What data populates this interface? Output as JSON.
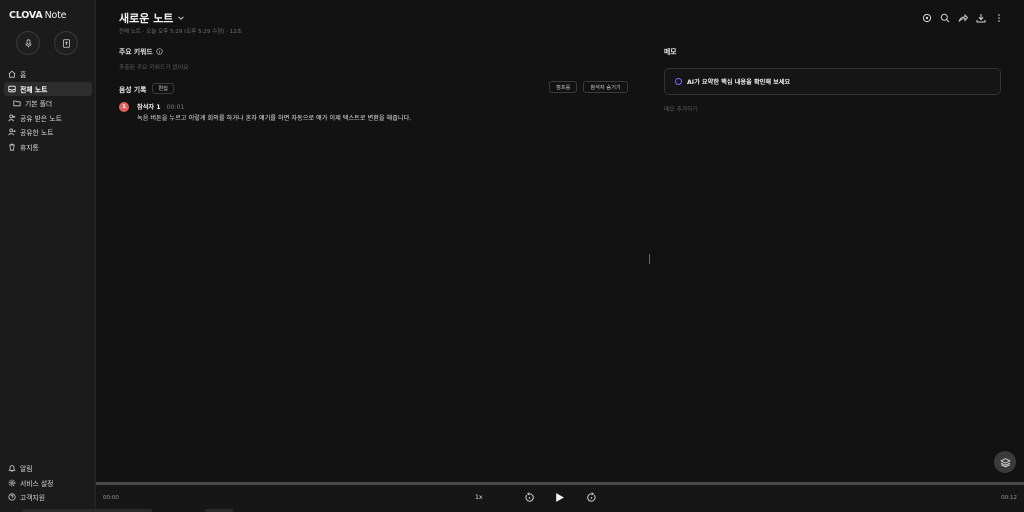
{
  "app": {
    "logo_bold": "CLOVA",
    "logo_light": "Note"
  },
  "sidebar": {
    "items": [
      {
        "label": "홈",
        "icon": "home-icon",
        "active": false
      },
      {
        "label": "전체 노트",
        "icon": "inbox-icon",
        "active": true
      },
      {
        "label": "기본 폴더",
        "icon": "folder-icon",
        "active": false
      },
      {
        "label": "공유 받은 노트",
        "icon": "user-received-icon",
        "active": false
      },
      {
        "label": "공유한 노트",
        "icon": "user-shared-icon",
        "active": false
      },
      {
        "label": "휴지통",
        "icon": "trash-icon",
        "active": false
      }
    ],
    "bottom": [
      {
        "label": "알림",
        "icon": "bell-icon"
      },
      {
        "label": "서비스 설정",
        "icon": "gear-icon"
      },
      {
        "label": "고객지원",
        "icon": "help-icon"
      }
    ]
  },
  "note": {
    "title": "새로운 노트",
    "meta": "전체 노트 · 오늘 오후 5:29 (오후 5:29 수정) · 12초"
  },
  "keywords": {
    "title": "주요 키워드",
    "empty": "추출된 주요 키워드가 없어요"
  },
  "recording": {
    "title": "음성 기록",
    "edit_label": "편집",
    "btn_jump": "점프를",
    "btn_hide_speaker": "참석자 숨기기"
  },
  "utterances": [
    {
      "speaker_index": "1",
      "speaker": "참석자 1",
      "time": "00:01",
      "text": "녹음 버튼을 누르고 이렇게 회의를 하거나 혼자 얘기를 하면 자동으로 얘가 이제 텍스트로 변환을 해줍니다."
    }
  ],
  "memo": {
    "title": "메모",
    "ai_prompt": "AI가 요약한 핵심 내용을 확인해 보세요",
    "add": "메모 추가하기"
  },
  "player": {
    "current": "00:00",
    "total": "00:12",
    "speed": "1x",
    "progress": 0.0
  },
  "colors": {
    "accent": "#8a63ff",
    "speaker": "#e25f5f"
  }
}
